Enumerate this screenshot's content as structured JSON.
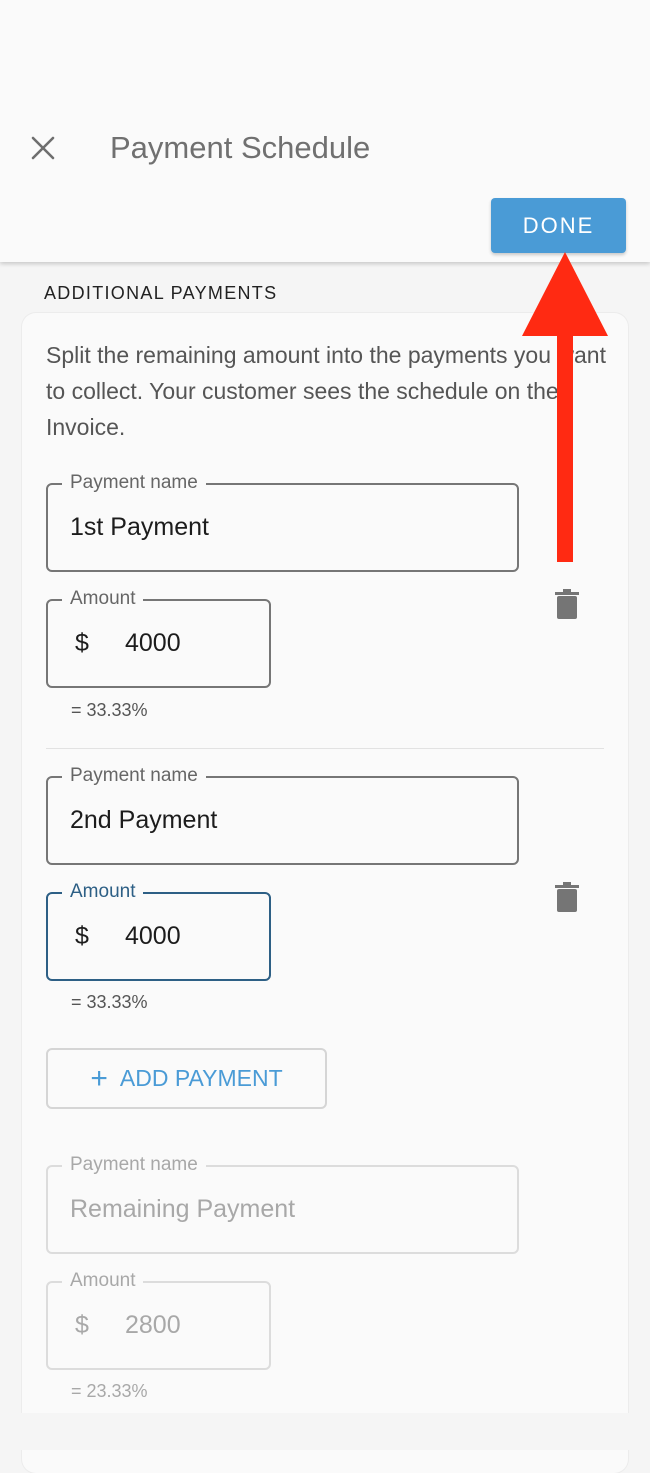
{
  "header": {
    "title": "Payment Schedule",
    "done_label": "DONE"
  },
  "section": {
    "label": "ADDITIONAL PAYMENTS",
    "description": "Split the remaining amount into the payments you want to collect. Your customer sees the schedule on the Invoice."
  },
  "payments": [
    {
      "name_label": "Payment name",
      "name_value": "1st Payment",
      "amount_label": "Amount",
      "currency": "$",
      "amount_value": "4000",
      "percent": "= 33.33%"
    },
    {
      "name_label": "Payment name",
      "name_value": "2nd Payment",
      "amount_label": "Amount",
      "currency": "$",
      "amount_value": "4000",
      "percent": "= 33.33%"
    }
  ],
  "add_payment": {
    "label": "ADD PAYMENT"
  },
  "remaining": {
    "name_label": "Payment name",
    "name_value": "Remaining Payment",
    "amount_label": "Amount",
    "currency": "$",
    "amount_value": "2800",
    "percent": "= 23.33%"
  },
  "colors": {
    "accent": "#4a9bd6",
    "focus": "#2d5f85",
    "annotation_arrow": "#ff2a12"
  },
  "icons": [
    "close-icon",
    "trash-icon",
    "plus-icon",
    "arrow-up-annotation"
  ]
}
